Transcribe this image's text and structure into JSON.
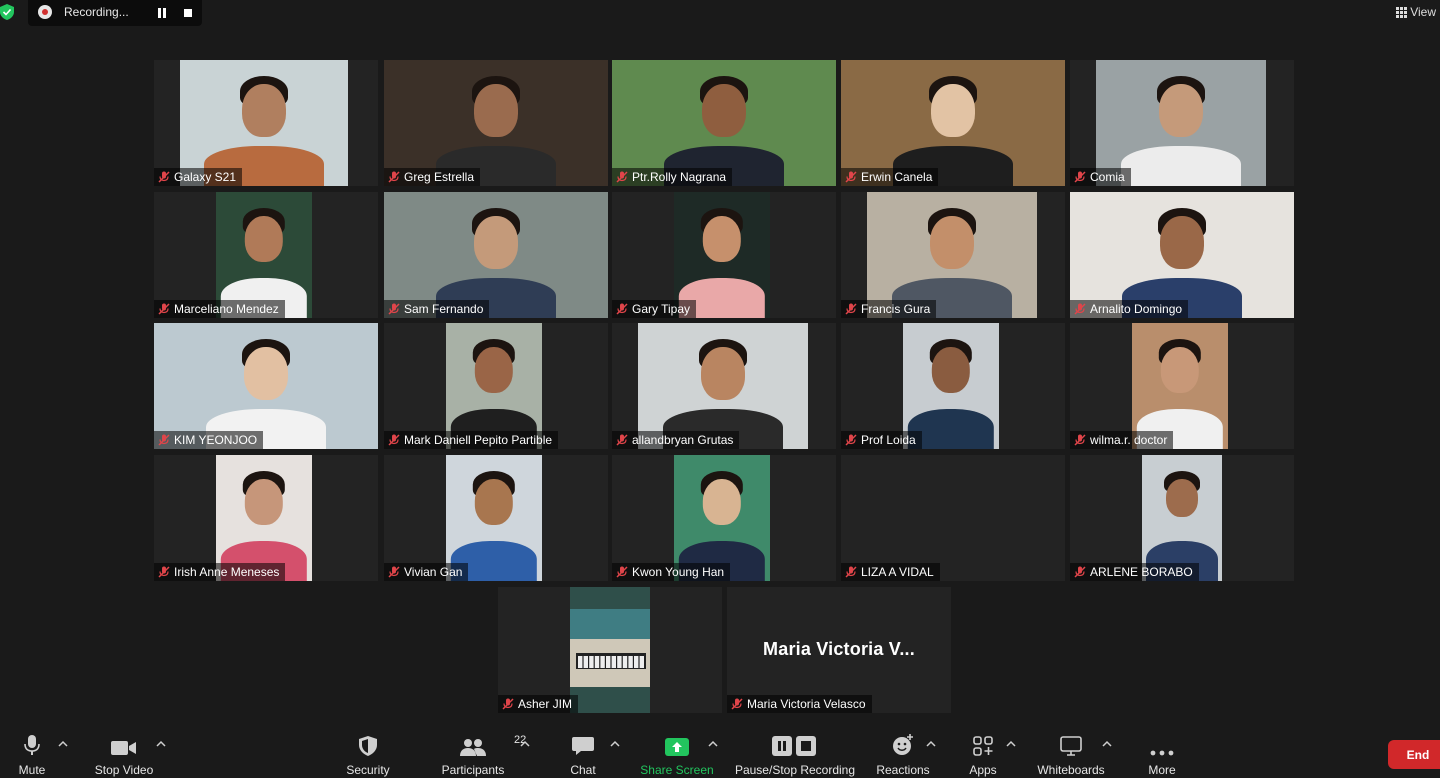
{
  "topbar": {
    "recording_label": "Recording...",
    "view_label": "View"
  },
  "participants": [
    {
      "name": "Galaxy S21",
      "bg": "#c9d3d5",
      "skin": "#b07f5f",
      "shirt": "#b86b3f"
    },
    {
      "name": "Greg Estrella",
      "bg": "#3b3028",
      "skin": "#9a6b4e",
      "shirt": "#2a2a2a",
      "speaking": true
    },
    {
      "name": "Ptr.Rolly Nagrana",
      "bg": "#5f8a4f",
      "skin": "#8f5e3f",
      "shirt": "#1f2430"
    },
    {
      "name": "Erwin Canela",
      "bg": "#8a6a45",
      "skin": "#e2c3a4",
      "shirt": "#1e1e1e"
    },
    {
      "name": "Comia",
      "bg": "#9aa2a4",
      "skin": "#c59a7a",
      "shirt": "#ececec"
    },
    {
      "name": "Marceliano Mendez",
      "bg": "#2c4a38",
      "skin": "#b07a58",
      "shirt": "#f0f0f0"
    },
    {
      "name": "Sam Fernando",
      "bg": "#7f8a86",
      "skin": "#c49a7a",
      "shirt": "#2f3d55"
    },
    {
      "name": "Gary Tipay",
      "bg": "#1e2a26",
      "skin": "#c6906c",
      "shirt": "#e9a8a8"
    },
    {
      "name": "Francis Gura",
      "bg": "#b8b0a2",
      "skin": "#c38f6a",
      "shirt": "#4f5763"
    },
    {
      "name": "Arnalito Domingo",
      "bg": "#e6e3de",
      "skin": "#9a6848",
      "shirt": "#2a3f6a"
    },
    {
      "name": "KIM YEONJOO",
      "bg": "#bcc9d0",
      "skin": "#e2c0a2",
      "shirt": "#f2f2f2"
    },
    {
      "name": "Mark Daniell Pepito Partible",
      "bg": "#a8b1a6",
      "skin": "#9a6547",
      "shirt": "#1f1f1f"
    },
    {
      "name": "allandbryan Grutas",
      "bg": "#cfd3d4",
      "skin": "#b98561",
      "shirt": "#2a2a2a"
    },
    {
      "name": "Prof Loida",
      "bg": "#c7ccd0",
      "skin": "#8a5c40",
      "shirt": "#1f3550"
    },
    {
      "name": "wilma.r. doctor",
      "bg": "#b98e6c",
      "skin": "#c89878",
      "shirt": "#f0f0f0"
    },
    {
      "name": "Irish Anne Meneses",
      "bg": "#e6e1de",
      "skin": "#c6967a",
      "shirt": "#d4506c"
    },
    {
      "name": "Vivian Gan",
      "bg": "#cfd6dc",
      "skin": "#a8764f",
      "shirt": "#2e5fa8"
    },
    {
      "name": "Kwon Young Han",
      "bg": "#3f8a6a",
      "skin": "#d8b492",
      "shirt": "#1f2a44"
    },
    {
      "name": "LIZA A VIDAL"
    },
    {
      "name": "ARLENE BORABO",
      "bg": "#c8ced2",
      "skin": "#9d6c4d",
      "shirt": "#2b3f66"
    },
    {
      "name": "Asher JIM",
      "bg": "#2f4f4a"
    },
    {
      "name": "Maria Victoria Velasco",
      "display_name": "Maria Victoria V..."
    }
  ],
  "toolbar": {
    "mute": "Mute",
    "stop_video": "Stop Video",
    "security": "Security",
    "participants": "Participants",
    "participants_count": "22",
    "chat": "Chat",
    "share_screen": "Share Screen",
    "pause_stop_recording": "Pause/Stop Recording",
    "reactions": "Reactions",
    "apps": "Apps",
    "whiteboards": "Whiteboards",
    "more": "More",
    "end": "End"
  },
  "colors": {
    "accent_green": "#22c55e",
    "speaking_border": "#d6d34a",
    "muted_red": "#e0454a",
    "end_red": "#d1282a"
  }
}
